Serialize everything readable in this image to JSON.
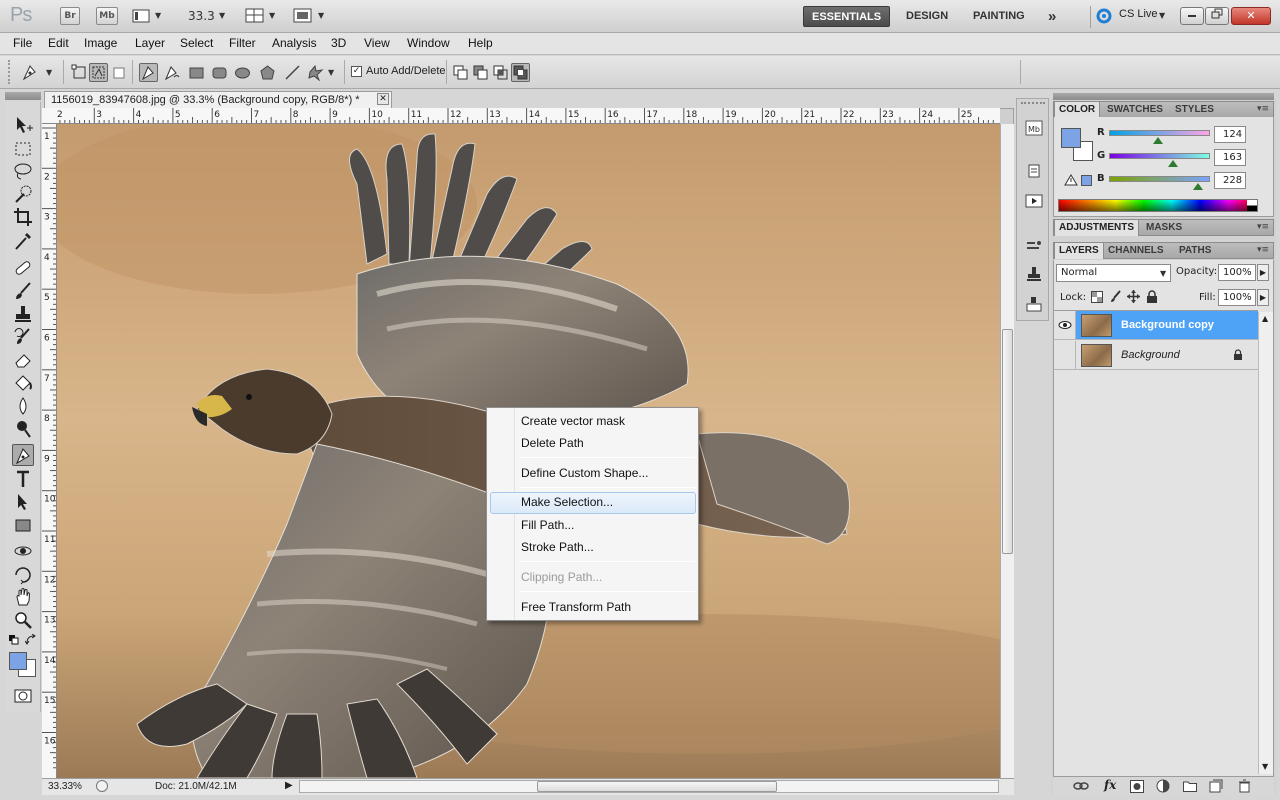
{
  "app": {
    "logo": "Ps",
    "bridge_label": "Br",
    "minibridge_label": "Mb",
    "zoom": "33.3",
    "workspaces": [
      "ESSENTIALS",
      "DESIGN",
      "PAINTING"
    ],
    "more": "»",
    "cs_live": "CS Live"
  },
  "menu": [
    "File",
    "Edit",
    "Image",
    "Layer",
    "Select",
    "Filter",
    "Analysis",
    "3D",
    "View",
    "Window",
    "Help"
  ],
  "options": {
    "auto_add_delete": "Auto Add/Delete"
  },
  "document": {
    "tab_title": "1156019_83947608.jpg @ 33.3% (Background copy, RGB/8*) *",
    "close_glyph": "✕",
    "ruler_top": [
      "2",
      "3",
      "4",
      "5",
      "6",
      "7",
      "8",
      "9",
      "10",
      "11",
      "12",
      "13",
      "14",
      "15",
      "16",
      "17",
      "18",
      "19",
      "20",
      "21",
      "22",
      "23",
      "24",
      "25"
    ],
    "ruler_left": [
      "1",
      "2",
      "3",
      "4",
      "5",
      "6",
      "7",
      "8",
      "9",
      "10",
      "11",
      "12",
      "13",
      "14",
      "15",
      "16"
    ],
    "status_zoom": "33.33%",
    "status_doc": "Doc: 21.0M/42.1M"
  },
  "context_menu": {
    "items": [
      {
        "label": "Create vector mask"
      },
      {
        "label": "Delete Path"
      },
      {
        "label": "Define Custom Shape..."
      },
      {
        "label": "Make Selection..."
      },
      {
        "label": "Fill Path..."
      },
      {
        "label": "Stroke Path..."
      },
      {
        "label": "Clipping Path..."
      },
      {
        "label": "Free Transform Path"
      }
    ],
    "highlighted": "Make Selection...",
    "disabled": "Clipping Path..."
  },
  "color_panel": {
    "tabs": [
      "COLOR",
      "SWATCHES",
      "STYLES"
    ],
    "channels": [
      {
        "name": "R",
        "value": "124"
      },
      {
        "name": "G",
        "value": "163"
      },
      {
        "name": "B",
        "value": "228"
      }
    ],
    "foreground_color": "#7ca3e4",
    "background_color": "#ffffff"
  },
  "adjustments_panel": {
    "tabs": [
      "ADJUSTMENTS",
      "MASKS"
    ]
  },
  "layers_panel": {
    "tabs": [
      "LAYERS",
      "CHANNELS",
      "PATHS"
    ],
    "blend_mode": "Normal",
    "opacity_label": "Opacity:",
    "opacity": "100%",
    "lock_label": "Lock:",
    "fill_label": "Fill:",
    "fill": "100%",
    "layers": [
      {
        "name": "Background copy",
        "selected": true,
        "visible": true
      },
      {
        "name": "Background",
        "selected": false,
        "visible": false
      }
    ],
    "footer_fx": "fx"
  },
  "colors": {
    "selection_blue": "#4fa3f7",
    "menu_highlight": "#dbe9f8",
    "workspace_active": "#4c4c4c"
  }
}
